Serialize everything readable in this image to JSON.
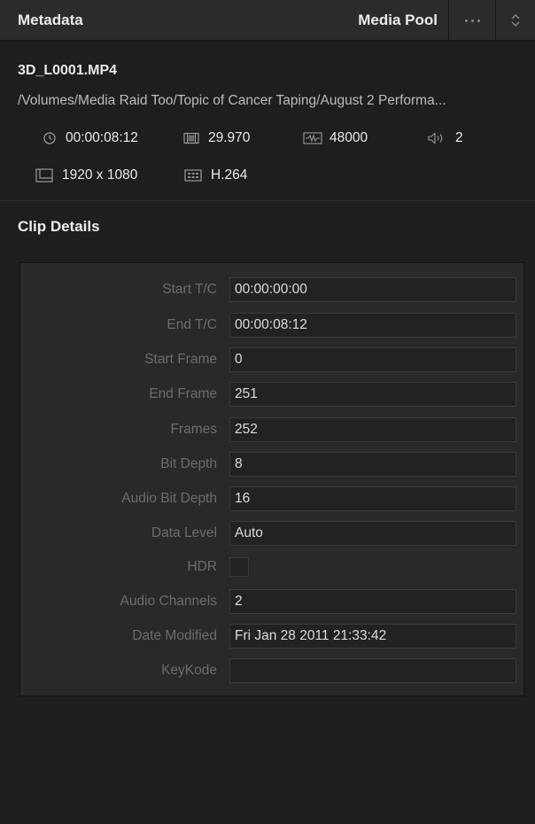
{
  "header": {
    "title": "Metadata",
    "media_pool_label": "Media Pool",
    "more_icon": "ellipsis-icon",
    "sort_icon": "sort-updown-icon"
  },
  "clip": {
    "name": "3D_L0001.MP4",
    "path": "/Volumes/Media Raid Too/Topic of Cancer Taping/August 2 Performa...",
    "stats": {
      "duration": "00:00:08:12",
      "fps": "29.970",
      "sample_rate": "48000",
      "audio_channels": "2",
      "resolution": "1920 x 1080",
      "codec": "H.264"
    }
  },
  "section": {
    "title": "Clip Details"
  },
  "details": {
    "start_tc": {
      "label": "Start T/C",
      "value": "00:00:00:00"
    },
    "end_tc": {
      "label": "End T/C",
      "value": "00:00:08:12"
    },
    "start_frame": {
      "label": "Start Frame",
      "value": "0"
    },
    "end_frame": {
      "label": "End Frame",
      "value": "251"
    },
    "frames": {
      "label": "Frames",
      "value": "252"
    },
    "bit_depth": {
      "label": "Bit Depth",
      "value": "8"
    },
    "audio_bit_depth": {
      "label": "Audio Bit Depth",
      "value": "16"
    },
    "data_level": {
      "label": "Data Level",
      "value": "Auto"
    },
    "hdr": {
      "label": "HDR",
      "checked": false
    },
    "audio_channels": {
      "label": "Audio Channels",
      "value": "2"
    },
    "date_modified": {
      "label": "Date Modified",
      "value": "Fri Jan 28 2011 21:33:42"
    },
    "keykode": {
      "label": "KeyKode",
      "value": ""
    }
  },
  "colors": {
    "background": "#1e1e20",
    "header_bg": "#2b2b2e",
    "box_bg": "#29292b",
    "field_bg": "#222224",
    "label_text": "#6c6c70",
    "value_text": "#dcdcdc"
  }
}
